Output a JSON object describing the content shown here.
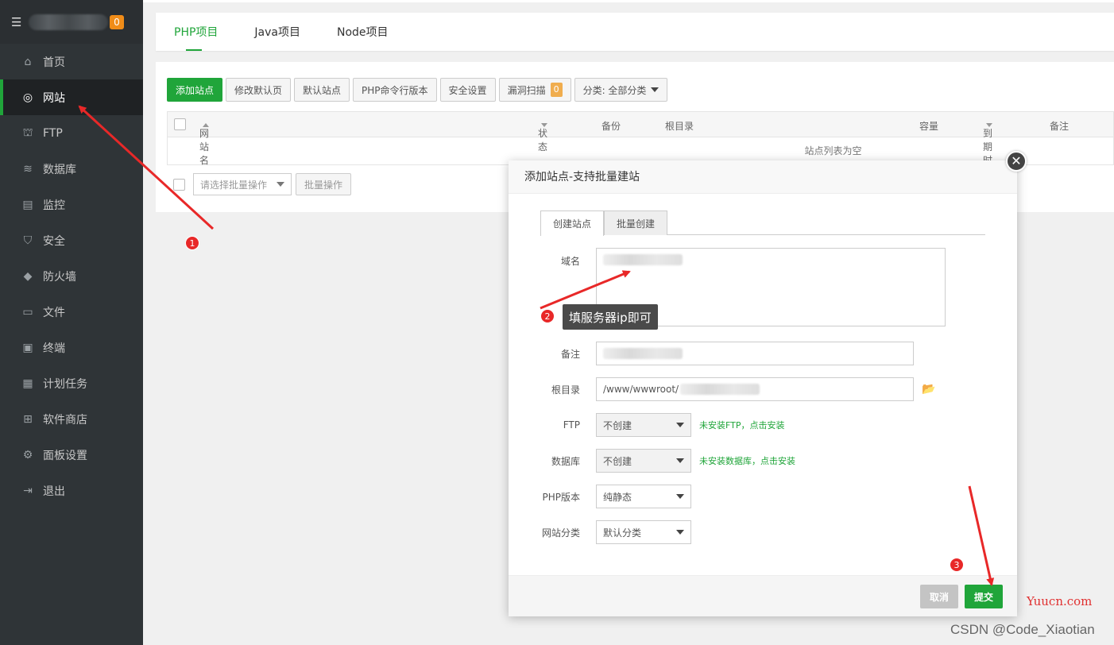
{
  "sidebar": {
    "badge": "0",
    "items": [
      {
        "label": "首页",
        "icon": "home-icon"
      },
      {
        "label": "网站",
        "icon": "globe-icon"
      },
      {
        "label": "FTP",
        "icon": "ftp-icon"
      },
      {
        "label": "数据库",
        "icon": "database-icon"
      },
      {
        "label": "监控",
        "icon": "monitor-icon"
      },
      {
        "label": "安全",
        "icon": "shield-icon"
      },
      {
        "label": "防火墙",
        "icon": "firewall-icon"
      },
      {
        "label": "文件",
        "icon": "folder-icon"
      },
      {
        "label": "终端",
        "icon": "terminal-icon"
      },
      {
        "label": "计划任务",
        "icon": "calendar-icon"
      },
      {
        "label": "软件商店",
        "icon": "apps-icon"
      },
      {
        "label": "面板设置",
        "icon": "settings-icon"
      },
      {
        "label": "退出",
        "icon": "logout-icon"
      }
    ]
  },
  "project_tabs": [
    "PHP项目",
    "Java项目",
    "Node项目"
  ],
  "toolbar": {
    "add_site": "添加站点",
    "modify_default": "修改默认页",
    "default_site": "默认站点",
    "php_cli": "PHP命令行版本",
    "security": "安全设置",
    "vuln_scan": "漏洞扫描",
    "vuln_count": "0",
    "category": "分类: 全部分类"
  },
  "table": {
    "headers": {
      "site_name": "网站名",
      "status": "状态",
      "backup": "备份",
      "root": "根目录",
      "capacity": "容量",
      "expire": "到期时间",
      "remark": "备注"
    },
    "empty": "站点列表为空"
  },
  "batch": {
    "placeholder": "请选择批量操作",
    "button": "批量操作"
  },
  "modal": {
    "title": "添加站点-支持批量建站",
    "tabs": [
      "创建站点",
      "批量创建"
    ],
    "domain_label": "域名",
    "remark_label": "备注",
    "root_label": "根目录",
    "root_value": "/www/wwwroot/",
    "ftp_label": "FTP",
    "ftp_value": "不创建",
    "ftp_hint": "未安装FTP，点击安装",
    "db_label": "数据库",
    "db_value": "不创建",
    "db_hint": "未安装数据库，点击安装",
    "php_label": "PHP版本",
    "php_value": "纯静态",
    "cat_label": "网站分类",
    "cat_value": "默认分类",
    "cancel": "取消",
    "submit": "提交"
  },
  "annotations": {
    "step1": "1",
    "step2": "2",
    "step3": "3",
    "tip": "填服务器ip即可"
  },
  "watermarks": {
    "yuucn": "Yuucn.com",
    "csdn": "CSDN @Code_Xiaotian"
  },
  "colors": {
    "brand_green": "#20a53a",
    "sidebar_bg": "#2f3437",
    "annotation_red": "#e82828"
  }
}
